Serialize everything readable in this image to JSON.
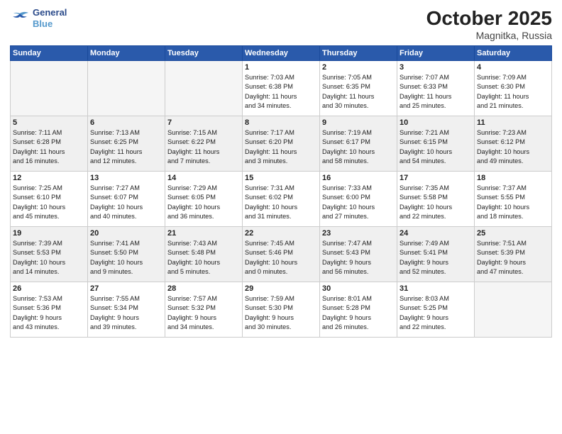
{
  "header": {
    "logo_line1": "General",
    "logo_line2": "Blue",
    "month": "October 2025",
    "location": "Magnitka, Russia"
  },
  "days_of_week": [
    "Sunday",
    "Monday",
    "Tuesday",
    "Wednesday",
    "Thursday",
    "Friday",
    "Saturday"
  ],
  "weeks": [
    [
      {
        "day": "",
        "info": ""
      },
      {
        "day": "",
        "info": ""
      },
      {
        "day": "",
        "info": ""
      },
      {
        "day": "1",
        "info": "Sunrise: 7:03 AM\nSunset: 6:38 PM\nDaylight: 11 hours\nand 34 minutes."
      },
      {
        "day": "2",
        "info": "Sunrise: 7:05 AM\nSunset: 6:35 PM\nDaylight: 11 hours\nand 30 minutes."
      },
      {
        "day": "3",
        "info": "Sunrise: 7:07 AM\nSunset: 6:33 PM\nDaylight: 11 hours\nand 25 minutes."
      },
      {
        "day": "4",
        "info": "Sunrise: 7:09 AM\nSunset: 6:30 PM\nDaylight: 11 hours\nand 21 minutes."
      }
    ],
    [
      {
        "day": "5",
        "info": "Sunrise: 7:11 AM\nSunset: 6:28 PM\nDaylight: 11 hours\nand 16 minutes."
      },
      {
        "day": "6",
        "info": "Sunrise: 7:13 AM\nSunset: 6:25 PM\nDaylight: 11 hours\nand 12 minutes."
      },
      {
        "day": "7",
        "info": "Sunrise: 7:15 AM\nSunset: 6:22 PM\nDaylight: 11 hours\nand 7 minutes."
      },
      {
        "day": "8",
        "info": "Sunrise: 7:17 AM\nSunset: 6:20 PM\nDaylight: 11 hours\nand 3 minutes."
      },
      {
        "day": "9",
        "info": "Sunrise: 7:19 AM\nSunset: 6:17 PM\nDaylight: 10 hours\nand 58 minutes."
      },
      {
        "day": "10",
        "info": "Sunrise: 7:21 AM\nSunset: 6:15 PM\nDaylight: 10 hours\nand 54 minutes."
      },
      {
        "day": "11",
        "info": "Sunrise: 7:23 AM\nSunset: 6:12 PM\nDaylight: 10 hours\nand 49 minutes."
      }
    ],
    [
      {
        "day": "12",
        "info": "Sunrise: 7:25 AM\nSunset: 6:10 PM\nDaylight: 10 hours\nand 45 minutes."
      },
      {
        "day": "13",
        "info": "Sunrise: 7:27 AM\nSunset: 6:07 PM\nDaylight: 10 hours\nand 40 minutes."
      },
      {
        "day": "14",
        "info": "Sunrise: 7:29 AM\nSunset: 6:05 PM\nDaylight: 10 hours\nand 36 minutes."
      },
      {
        "day": "15",
        "info": "Sunrise: 7:31 AM\nSunset: 6:02 PM\nDaylight: 10 hours\nand 31 minutes."
      },
      {
        "day": "16",
        "info": "Sunrise: 7:33 AM\nSunset: 6:00 PM\nDaylight: 10 hours\nand 27 minutes."
      },
      {
        "day": "17",
        "info": "Sunrise: 7:35 AM\nSunset: 5:58 PM\nDaylight: 10 hours\nand 22 minutes."
      },
      {
        "day": "18",
        "info": "Sunrise: 7:37 AM\nSunset: 5:55 PM\nDaylight: 10 hours\nand 18 minutes."
      }
    ],
    [
      {
        "day": "19",
        "info": "Sunrise: 7:39 AM\nSunset: 5:53 PM\nDaylight: 10 hours\nand 14 minutes."
      },
      {
        "day": "20",
        "info": "Sunrise: 7:41 AM\nSunset: 5:50 PM\nDaylight: 10 hours\nand 9 minutes."
      },
      {
        "day": "21",
        "info": "Sunrise: 7:43 AM\nSunset: 5:48 PM\nDaylight: 10 hours\nand 5 minutes."
      },
      {
        "day": "22",
        "info": "Sunrise: 7:45 AM\nSunset: 5:46 PM\nDaylight: 10 hours\nand 0 minutes."
      },
      {
        "day": "23",
        "info": "Sunrise: 7:47 AM\nSunset: 5:43 PM\nDaylight: 9 hours\nand 56 minutes."
      },
      {
        "day": "24",
        "info": "Sunrise: 7:49 AM\nSunset: 5:41 PM\nDaylight: 9 hours\nand 52 minutes."
      },
      {
        "day": "25",
        "info": "Sunrise: 7:51 AM\nSunset: 5:39 PM\nDaylight: 9 hours\nand 47 minutes."
      }
    ],
    [
      {
        "day": "26",
        "info": "Sunrise: 7:53 AM\nSunset: 5:36 PM\nDaylight: 9 hours\nand 43 minutes."
      },
      {
        "day": "27",
        "info": "Sunrise: 7:55 AM\nSunset: 5:34 PM\nDaylight: 9 hours\nand 39 minutes."
      },
      {
        "day": "28",
        "info": "Sunrise: 7:57 AM\nSunset: 5:32 PM\nDaylight: 9 hours\nand 34 minutes."
      },
      {
        "day": "29",
        "info": "Sunrise: 7:59 AM\nSunset: 5:30 PM\nDaylight: 9 hours\nand 30 minutes."
      },
      {
        "day": "30",
        "info": "Sunrise: 8:01 AM\nSunset: 5:28 PM\nDaylight: 9 hours\nand 26 minutes."
      },
      {
        "day": "31",
        "info": "Sunrise: 8:03 AM\nSunset: 5:25 PM\nDaylight: 9 hours\nand 22 minutes."
      },
      {
        "day": "",
        "info": ""
      }
    ]
  ]
}
